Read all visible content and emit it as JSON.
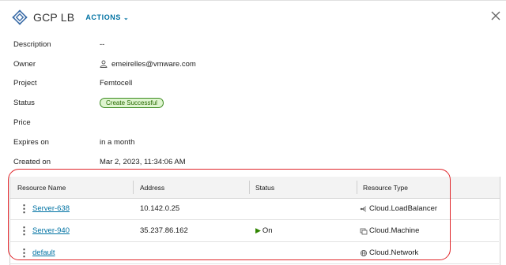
{
  "header": {
    "title": "GCP LB",
    "actions_label": "ACTIONS"
  },
  "colors": {
    "accent": "#0072a3",
    "badge_border": "#3b8a1f",
    "badge_bg": "#dff5d0",
    "highlight": "#e0262b",
    "on_status": "#2f8400"
  },
  "properties": [
    {
      "label": "Description",
      "value": "--"
    },
    {
      "label": "Owner",
      "value": "emeirelles@vmware.com",
      "icon": "user-icon"
    },
    {
      "label": "Project",
      "value": "Femtocell"
    },
    {
      "label": "Status",
      "value": "Create Successful",
      "badge": true
    },
    {
      "label": "Price",
      "value": ""
    },
    {
      "label": "Expires on",
      "value": "in a month"
    },
    {
      "label": "Created on",
      "value": "Mar 2, 2023, 11:34:06 AM"
    }
  ],
  "table": {
    "headers": [
      "Resource Name",
      "Address",
      "Status",
      "Resource Type"
    ],
    "rows": [
      {
        "name": "Server-638",
        "address": "10.142.0.25",
        "status": "",
        "type": "Cloud.LoadBalancer",
        "type_icon": "load-balancer-icon"
      },
      {
        "name": "Server-940",
        "address": "35.237.86.162",
        "status": "On",
        "type": "Cloud.Machine",
        "type_icon": "machine-icon"
      },
      {
        "name": "default",
        "address": "",
        "status": "",
        "type": "Cloud.Network",
        "type_icon": "network-icon"
      }
    ]
  }
}
